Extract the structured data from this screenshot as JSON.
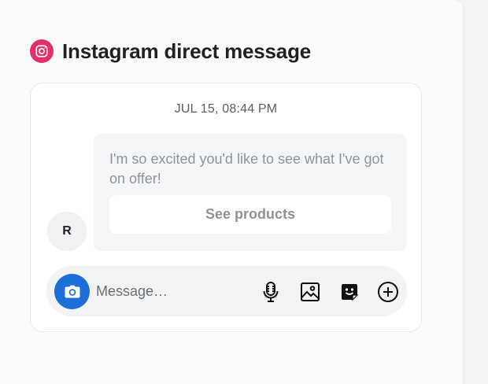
{
  "header": {
    "title": "Instagram direct message",
    "brand_color": "#e1306c"
  },
  "conversation": {
    "timestamp": "JUL 15, 08:44 PM",
    "avatar_initial": "R",
    "message": {
      "text": "I'm so excited you'd like to see what I've got on offer!",
      "button_label": "See products"
    }
  },
  "composer": {
    "camera_icon": "camera-icon",
    "placeholder": "Message…",
    "value": "",
    "tools": [
      "microphone-icon",
      "image-icon",
      "sticker-icon",
      "add-circle-icon"
    ],
    "accent_color": "#1b6fd6"
  }
}
